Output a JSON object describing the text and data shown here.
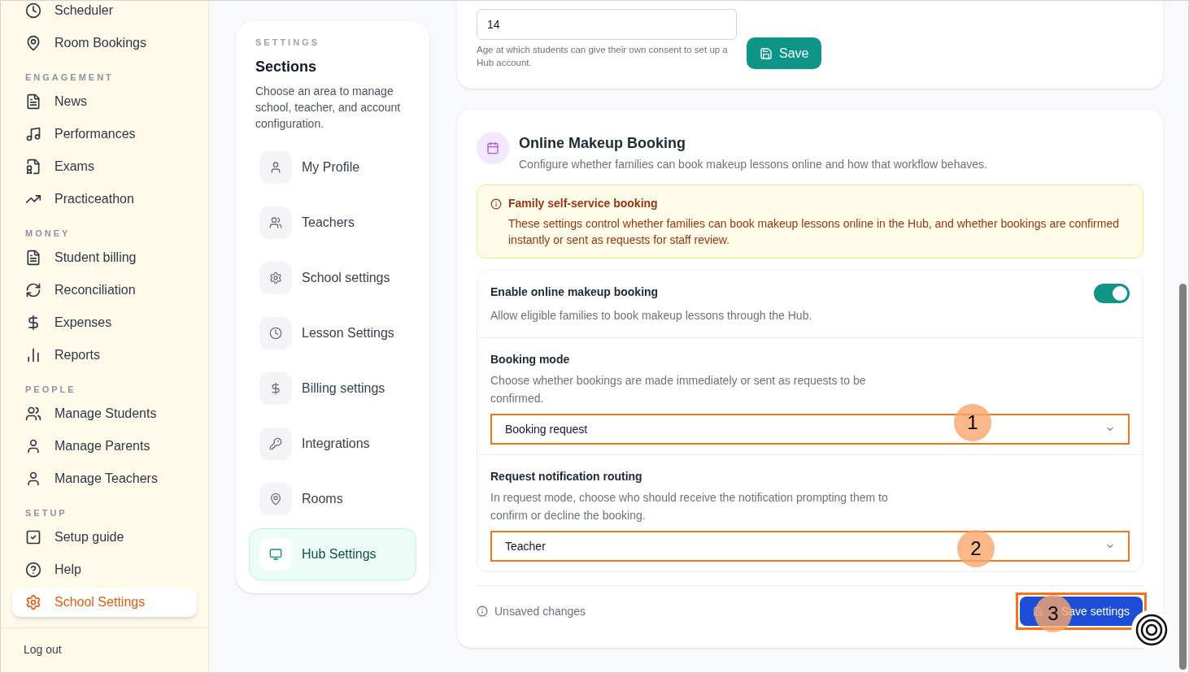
{
  "sidebar": {
    "groups": [
      {
        "items": [
          {
            "label": "Scheduler",
            "selected": false
          },
          {
            "label": "Room Bookings",
            "selected": false
          }
        ]
      },
      {
        "heading": "ENGAGEMENT",
        "items": [
          {
            "label": "News",
            "selected": false
          },
          {
            "label": "Performances",
            "selected": false
          },
          {
            "label": "Exams",
            "selected": false
          },
          {
            "label": "Practiceathon",
            "selected": false
          }
        ]
      },
      {
        "heading": "MONEY",
        "items": [
          {
            "label": "Student billing",
            "selected": false
          },
          {
            "label": "Reconciliation",
            "selected": false
          },
          {
            "label": "Expenses",
            "selected": false
          },
          {
            "label": "Reports",
            "selected": false
          }
        ]
      },
      {
        "heading": "PEOPLE",
        "items": [
          {
            "label": "Manage Students",
            "selected": false
          },
          {
            "label": "Manage Parents",
            "selected": false
          },
          {
            "label": "Manage Teachers",
            "selected": false
          }
        ]
      },
      {
        "heading": "SETUP",
        "items": [
          {
            "label": "Setup guide",
            "selected": false
          },
          {
            "label": "Help",
            "selected": false
          },
          {
            "label": "School Settings",
            "selected": true
          }
        ]
      }
    ],
    "logout": "Log out"
  },
  "sections": {
    "eyebrow": "SETTINGS",
    "title": "Sections",
    "description": "Choose an area to manage school, teacher, and account configuration.",
    "items": [
      {
        "label": "My Profile",
        "selected": false
      },
      {
        "label": "Teachers",
        "selected": false
      },
      {
        "label": "School settings",
        "selected": false
      },
      {
        "label": "Lesson Settings",
        "selected": false
      },
      {
        "label": "Billing settings",
        "selected": false
      },
      {
        "label": "Integrations",
        "selected": false
      },
      {
        "label": "Rooms",
        "selected": false
      },
      {
        "label": "Hub Settings",
        "selected": true
      }
    ]
  },
  "consent_card": {
    "value": "14",
    "help": "Age at which students can give their own consent to set up a Hub account.",
    "save": "Save"
  },
  "booking_card": {
    "title": "Online Makeup Booking",
    "subtitle": "Configure whether families can book makeup lessons online and how that workflow behaves.",
    "alert": {
      "title": "Family self-service booking",
      "body": "These settings control whether families can book makeup lessons online in the Hub, and whether bookings are confirmed instantly or sent as requests for staff review."
    },
    "rows": [
      {
        "kind": "toggle",
        "label": "Enable online makeup booking",
        "description": "Allow eligible families to book makeup lessons through the Hub.",
        "on": true
      },
      {
        "kind": "select",
        "label": "Booking mode",
        "description": "Choose whether bookings are made immediately or sent as requests to be confirmed.",
        "value": "Booking request",
        "callout": "1"
      },
      {
        "kind": "select",
        "label": "Request notification routing",
        "description": "In request mode, choose who should receive the notification prompting them to confirm or decline the booking.",
        "value": "Teacher",
        "callout": "2"
      }
    ],
    "status": "Unsaved changes",
    "save": "Save settings",
    "save_callout": "3"
  }
}
